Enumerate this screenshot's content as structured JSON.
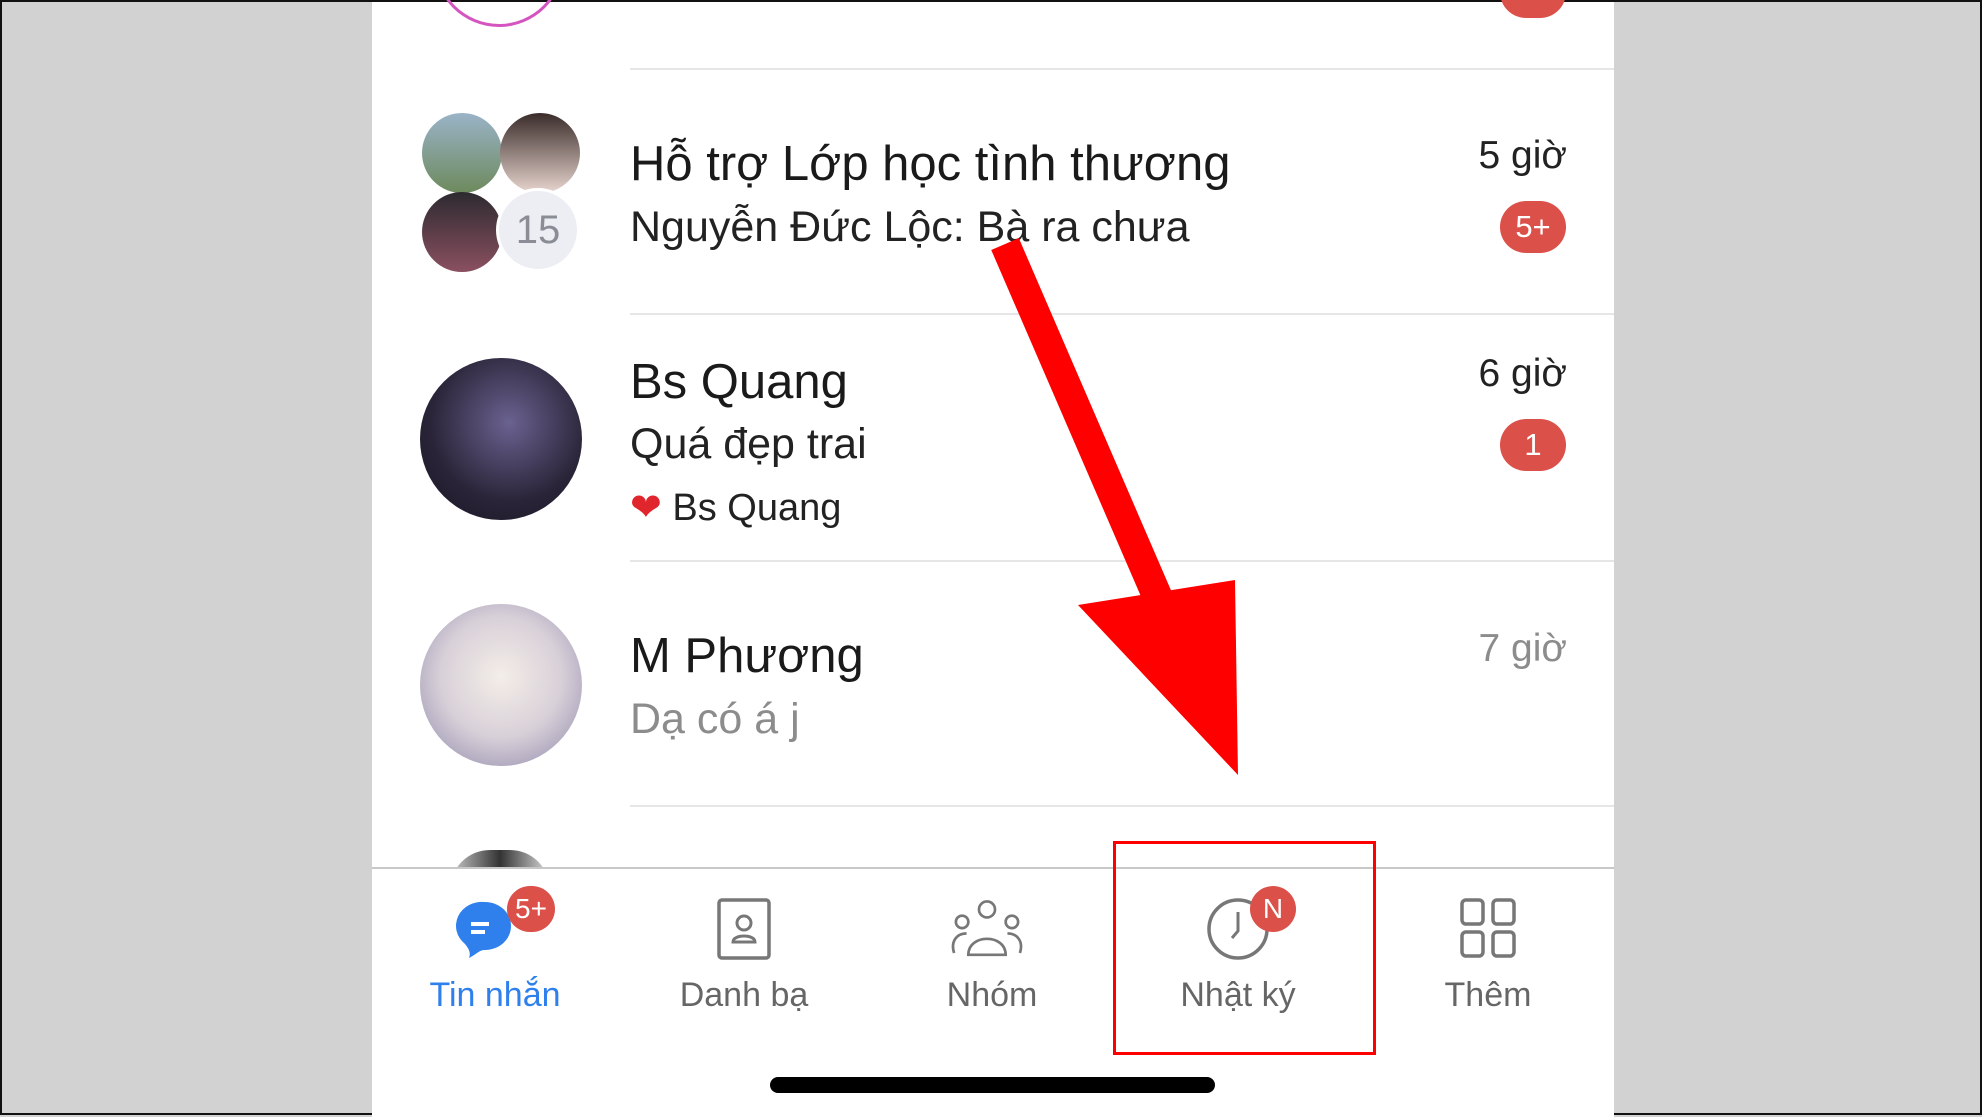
{
  "conversations": [
    {
      "title": "Hỗ trợ Lớp học tình thương",
      "preview": "Nguyễn Đức Lộc: Bà ra chưa",
      "time": "5 giờ",
      "badge": "5+",
      "member_count": "15"
    },
    {
      "title": "Bs Quang",
      "preview": "Quá đẹp trai",
      "reaction_text": "Bs Quang",
      "time": "6 giờ",
      "badge": "1",
      "reaction_icon": "heart-icon"
    },
    {
      "title": "M Phương",
      "preview": "Dạ có á j",
      "time": "7 giờ"
    }
  ],
  "tabs": [
    {
      "label": "Tin nhắn",
      "badge": "5+",
      "active": true,
      "icon": "chat-icon"
    },
    {
      "label": "Danh bạ",
      "icon": "contacts-icon"
    },
    {
      "label": "Nhóm",
      "icon": "group-icon"
    },
    {
      "label": "Nhật ký",
      "badge": "N",
      "icon": "clock-icon",
      "highlighted": true
    },
    {
      "label": "Thêm",
      "icon": "grid-icon"
    }
  ],
  "colors": {
    "accent": "#2f80ed",
    "badge": "#db5048",
    "annotation": "#ff0000"
  }
}
